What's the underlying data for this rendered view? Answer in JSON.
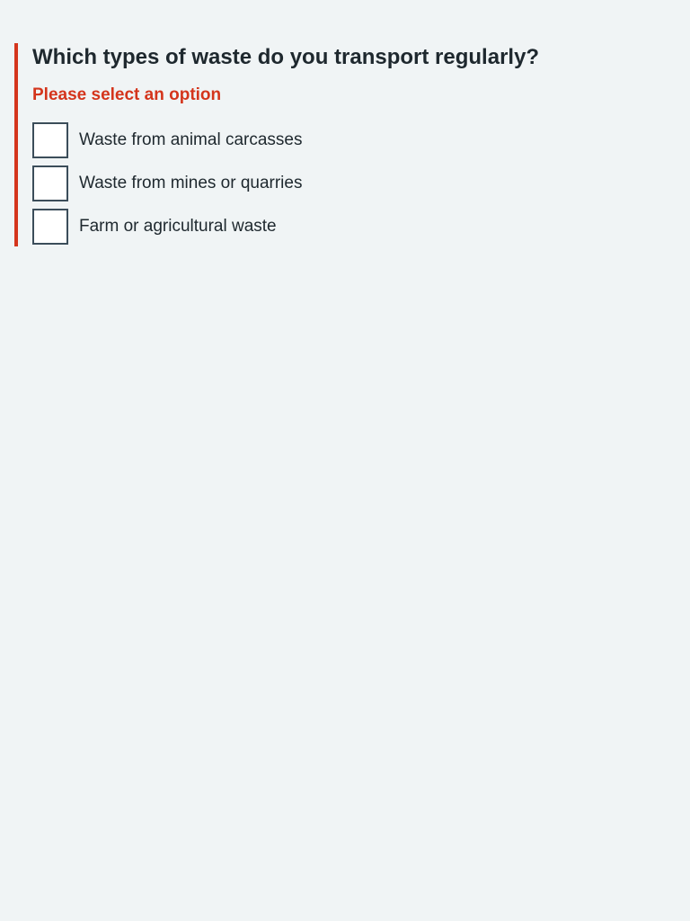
{
  "question": {
    "title": "Which types of waste do you transport regularly?",
    "error": "Please select an option"
  },
  "options": [
    {
      "label": "Waste from animal carcasses",
      "checked": false
    },
    {
      "label": "Waste from mines or quarries",
      "checked": false
    },
    {
      "label": "Farm or agricultural waste",
      "checked": false
    }
  ],
  "colors": {
    "background": "#f0f4f5",
    "error": "#d4351c",
    "text": "#1e282e",
    "checkbox_border": "#3b4d5a"
  }
}
